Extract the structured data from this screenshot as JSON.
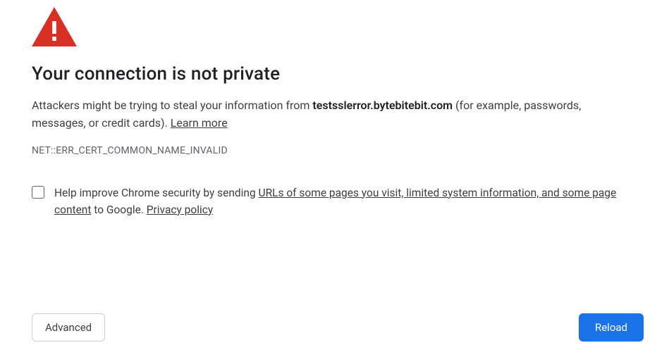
{
  "title": "Your connection is not private",
  "description_prefix": "Attackers might be trying to steal your information from ",
  "domain": "testsslerror.bytebitebit.com",
  "description_suffix": " (for example, passwords, messages, or credit cards). ",
  "learn_more": "Learn more",
  "error_code": "NET::ERR_CERT_COMMON_NAME_INVALID",
  "improve_prefix": "Help improve Chrome security by sending ",
  "improve_link1": "URLs of some pages you visit, limited system information, and some page content",
  "improve_mid": " to Google. ",
  "privacy_policy": "Privacy policy",
  "buttons": {
    "advanced": "Advanced",
    "reload": "Reload"
  },
  "icon_color": "#d93025"
}
